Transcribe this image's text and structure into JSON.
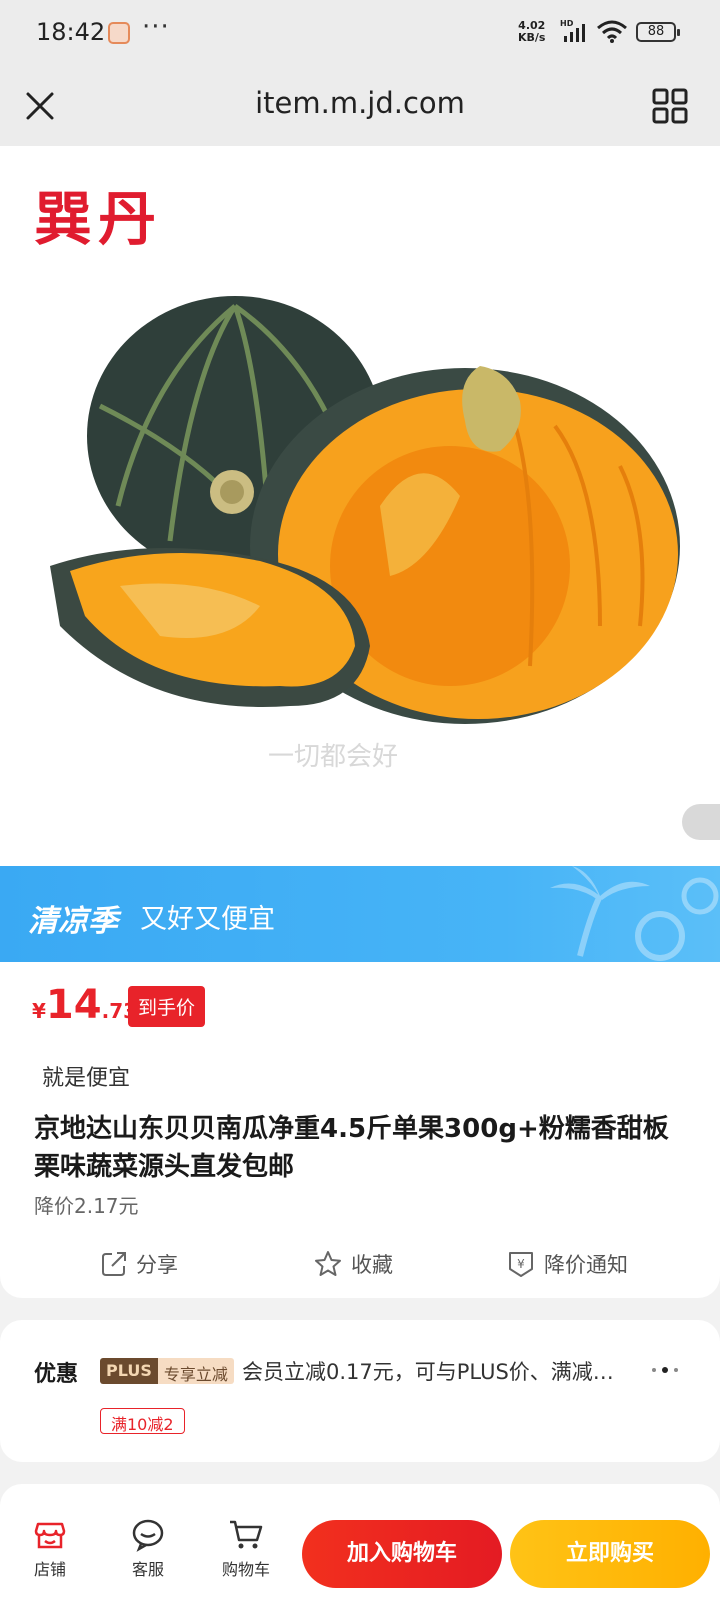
{
  "status_bar": {
    "time": "18:42",
    "more": "···",
    "speed_value": "4.02",
    "speed_unit": "KB/s",
    "network": "HD",
    "battery": "88"
  },
  "browser": {
    "url": "item.m.jd.com",
    "close_icon": "close-icon",
    "menu_icon": "grid-icon"
  },
  "hero": {
    "brand": "巽丹",
    "watermark": "一切都会好"
  },
  "banner": {
    "title": "清凉季",
    "subtitle": "又好又便宜",
    "color": "#3aa9f3"
  },
  "product": {
    "currency": "¥",
    "price_int": "14",
    "price_dec": ".73",
    "price_tag": "到手价",
    "slogan": "就是便宜",
    "title": " 京地达山东贝贝南瓜净重4.5斤单果300g+粉糯香甜板栗味蔬菜源头直发包邮",
    "price_drop": "降价2.17元",
    "accent_color": "#e8232a"
  },
  "actions": {
    "share": "分享",
    "favorite": "收藏",
    "price_alert": "降价通知"
  },
  "offer": {
    "label": "优惠",
    "plus_badge": "PLUS",
    "plus_badge_text": "专享立减",
    "text": "会员立减0.17元，可与PLUS价、满减…",
    "coupon": "满10减2"
  },
  "bottom_nav": {
    "store": "店铺",
    "service": "客服",
    "cart": "购物车",
    "add_to_cart": "加入购物车",
    "buy_now": "立即购买"
  }
}
